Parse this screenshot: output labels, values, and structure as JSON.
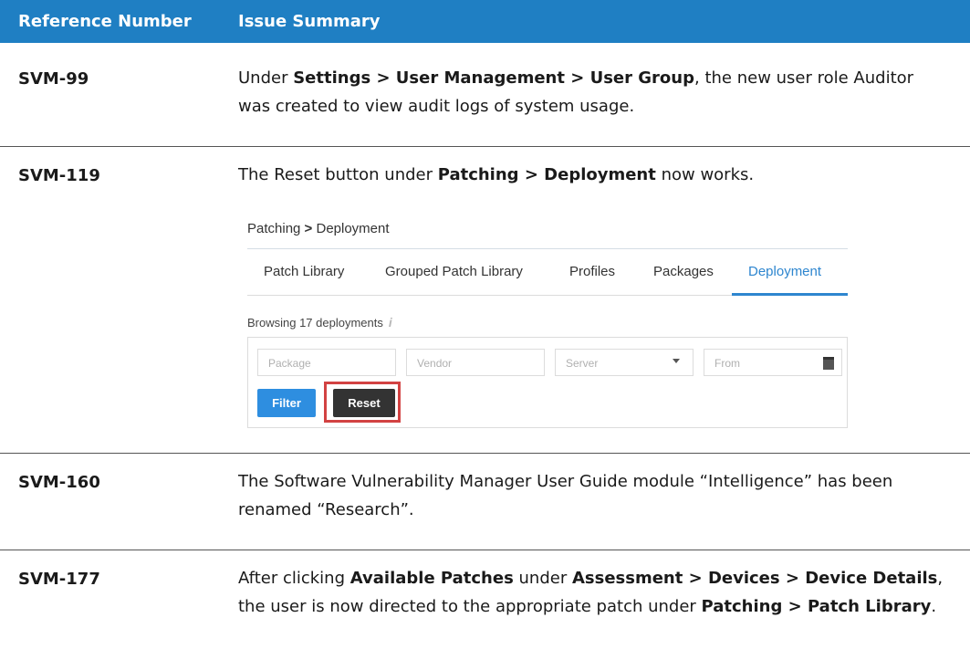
{
  "table": {
    "headers": [
      "Reference Number",
      "Issue Summary"
    ],
    "rows": [
      {
        "ref": "SVM-99",
        "parts": [
          {
            "t": "Under ",
            "b": false
          },
          {
            "t": "Settings > User Management > User Group",
            "b": true
          },
          {
            "t": ", the new user role Auditor was created to view audit logs of system usage.",
            "b": false
          }
        ]
      },
      {
        "ref": "SVM-119",
        "parts": [
          {
            "t": "The Reset button under ",
            "b": false
          },
          {
            "t": "Patching > Deployment",
            "b": true
          },
          {
            "t": " now works.",
            "b": false
          }
        ]
      },
      {
        "ref": "SVM-160",
        "parts": [
          {
            "t": "The Software Vulnerability Manager User Guide module “Intelligence” has been renamed “Research”.",
            "b": false
          }
        ]
      },
      {
        "ref": "SVM-177",
        "parts": [
          {
            "t": "After clicking ",
            "b": false
          },
          {
            "t": "Available Patches",
            "b": true
          },
          {
            "t": " under ",
            "b": false
          },
          {
            "t": "Assessment > Devices > Device Details",
            "b": true
          },
          {
            "t": ", the user is now directed to the appropriate patch under ",
            "b": false
          },
          {
            "t": "Patching > Patch Library",
            "b": true
          },
          {
            "t": ".",
            "b": false
          }
        ]
      }
    ]
  },
  "screenshot": {
    "breadcrumb_a": "Patching",
    "breadcrumb_sep": ">",
    "breadcrumb_b": "Deployment",
    "tabs": [
      "Patch Library",
      "Grouped Patch Library",
      "Profiles",
      "Packages",
      "Deployment"
    ],
    "active_tab": "Deployment",
    "browsing_text": "Browsing 17 deployments",
    "info_icon": "info-icon",
    "fields": {
      "package_placeholder": "Package",
      "vendor_placeholder": "Vendor",
      "server_placeholder": "Server",
      "from_placeholder": "From"
    },
    "filter_button": "Filter",
    "reset_button": "Reset",
    "colors": {
      "header_bg": "#1f7fc3",
      "accent": "#2e86cf",
      "highlight": "#d24242"
    }
  }
}
